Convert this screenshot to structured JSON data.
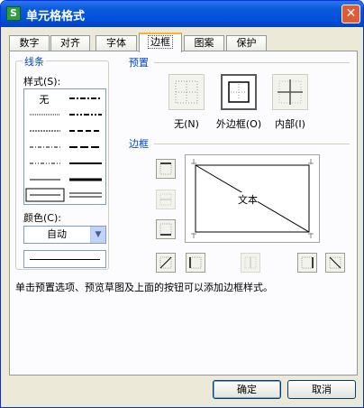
{
  "window": {
    "title": "单元格格式",
    "app_icon_letter": "S",
    "close_symbol": "✕"
  },
  "tabs": [
    {
      "label": "数字",
      "active": false
    },
    {
      "label": "对齐",
      "active": false
    },
    {
      "label": "字体",
      "active": false
    },
    {
      "label": "边框",
      "active": true
    },
    {
      "label": "图案",
      "active": false
    },
    {
      "label": "保护",
      "active": false
    }
  ],
  "line_group": {
    "title": "线条",
    "style_label": "样式(S):",
    "none_label": "无",
    "color_label": "颜色(C):",
    "color_value": "自动"
  },
  "preset_group": {
    "title": "预置",
    "buttons": [
      {
        "label": "无(N)",
        "icon": "border-none-icon"
      },
      {
        "label": "外边框(O)",
        "icon": "border-outline-icon"
      },
      {
        "label": "内部(I)",
        "icon": "border-inside-icon"
      }
    ]
  },
  "border_group": {
    "title": "边框",
    "preview_text": "文本"
  },
  "hint": "单击预置选项、预览草图及上面的按钮可以添加边框样式。",
  "buttons": {
    "ok": "确定",
    "cancel": "取消"
  },
  "colors": {
    "accent": "#0046d5",
    "title_bar": "#0050e0",
    "tab_highlight": "#f8b33d"
  }
}
